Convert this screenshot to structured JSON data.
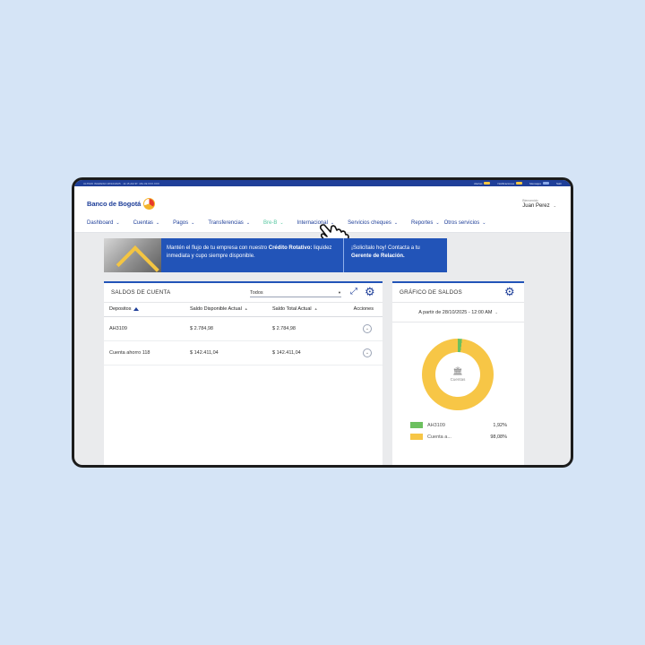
{
  "topbar": {
    "left_text": "ULTIMO INGRESO 28/10/2025 · 11:15 AM IP: 181.49.XXX.XXX",
    "items": [
      {
        "label": "Alertas"
      },
      {
        "label": "Notificaciones"
      },
      {
        "label": "Mensajes"
      },
      {
        "label": "Salir"
      }
    ]
  },
  "header": {
    "logo_text": "Banco de Bogotá",
    "user_label": "Bienvenido",
    "user_name": "Juan Perez",
    "user_chevron": "⌄"
  },
  "nav": [
    {
      "label": "Dashboard"
    },
    {
      "label": "Cuentas"
    },
    {
      "label": "Pagos"
    },
    {
      "label": "Transferencias"
    },
    {
      "label": "Bre-B"
    },
    {
      "label": "Internacional"
    },
    {
      "label": "Servicios cheques"
    },
    {
      "label": "Reportes"
    },
    {
      "label": "Otros servicios"
    }
  ],
  "banner": {
    "text_a": "Mantén el flujo de tu empresa con nuestro ",
    "text_b": "Crédito Rotativo:",
    "text_c": " liquidez inmediata y cupo siempre disponible.",
    "cta_a": "¡Solicítalo hoy! Contacta a tu ",
    "cta_b": "Gerente de Relación."
  },
  "saldos": {
    "title": "SALDOS DE CUENTA",
    "filter_value": "Todos",
    "columns": [
      "Depositos",
      "Saldo Disponible Actual",
      "Saldo Total Actual",
      "Acciones"
    ],
    "rows": [
      {
        "cuenta": "AH3109",
        "disponible": "$ 2.784,98",
        "total": "$ 2.784,98"
      },
      {
        "cuenta": "Cuenta ahorro 118",
        "disponible": "$ 142.411,04",
        "total": "$ 142.411,04"
      }
    ]
  },
  "grafico": {
    "title": "GRÁFICO DE SALDOS",
    "date_label": "A partir de 28/10/2025 - 12:00 AM",
    "center_label": "Cuentas",
    "legend": [
      {
        "name": "AH3109",
        "percent": "1,92%",
        "value": 1.92,
        "color": "#6cc05f"
      },
      {
        "name": "Cuenta a...",
        "percent": "98,08%",
        "value": 98.08,
        "color": "#f7c646"
      }
    ]
  },
  "colors": {
    "brand_blue": "#1f3f99",
    "accent_green": "#56c7a0",
    "banner_blue": "#2254b8"
  },
  "icons": {
    "expand": "expand-icon",
    "settings": "gear-icon",
    "bank": "bank-icon",
    "cursor": "hand-pointer-icon"
  }
}
